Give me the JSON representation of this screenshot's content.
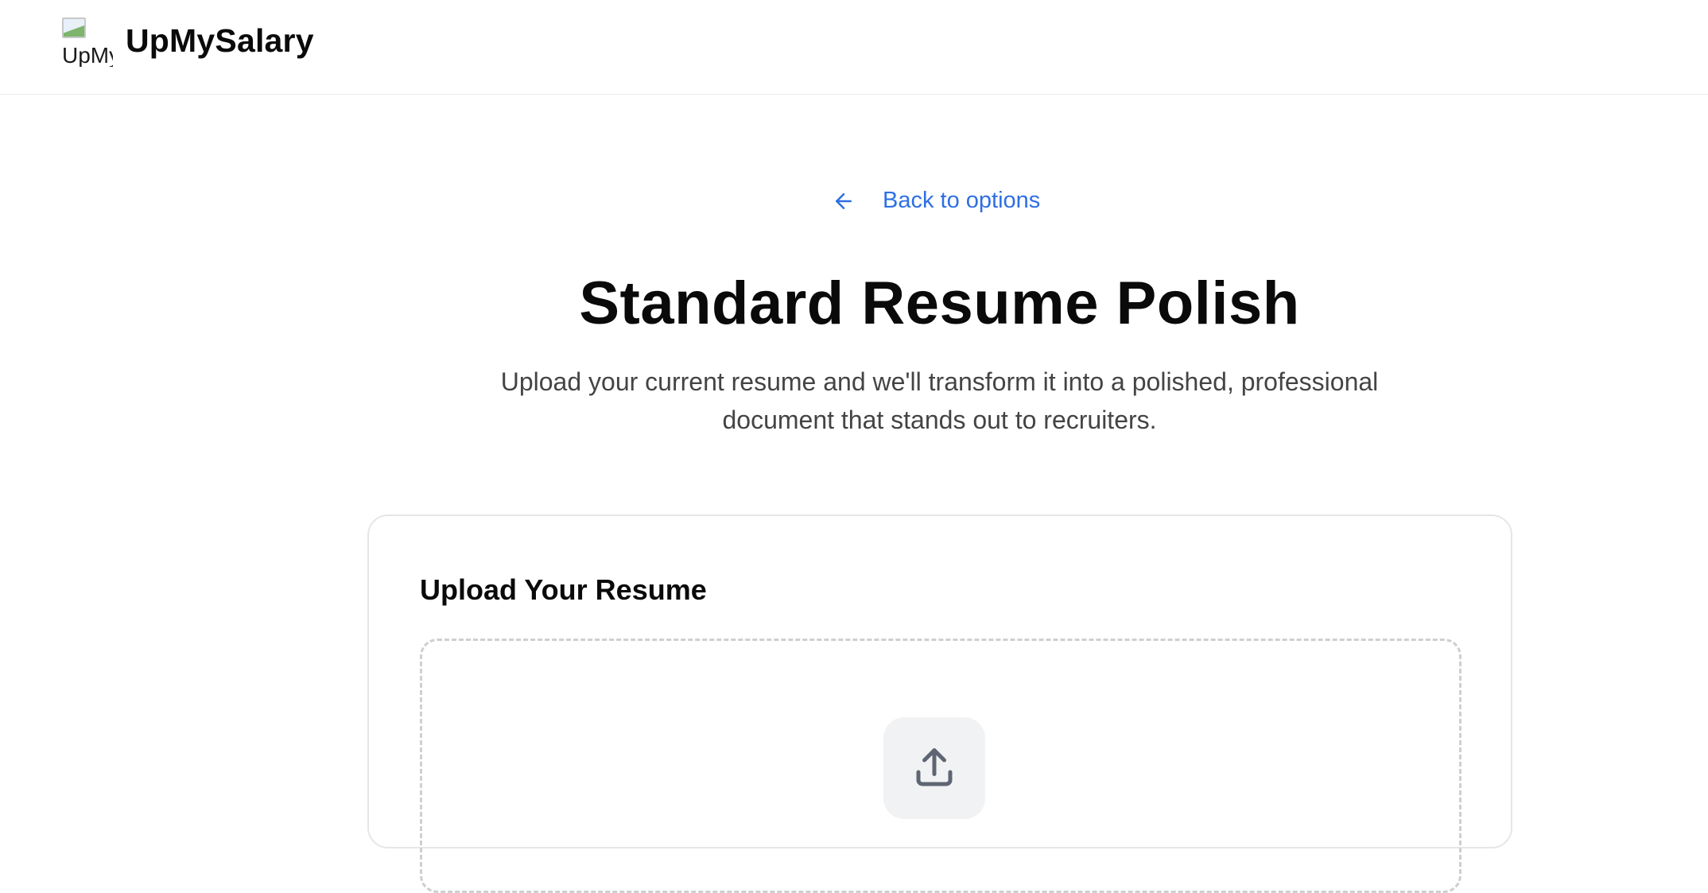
{
  "header": {
    "logo_alt": "UpMySalary",
    "brand_name": "UpMySalary"
  },
  "nav": {
    "back_label": "Back to options"
  },
  "hero": {
    "title": "Standard Resume Polish",
    "subtitle": "Upload your current resume and we'll transform it into a polished, professional document that stands out to recruiters."
  },
  "upload_card": {
    "title": "Upload Your Resume",
    "icon": "upload-icon"
  },
  "colors": {
    "accent": "#2f6fe4",
    "text": "#0a0a0a",
    "muted": "#444444",
    "border": "#e6e6e6"
  }
}
